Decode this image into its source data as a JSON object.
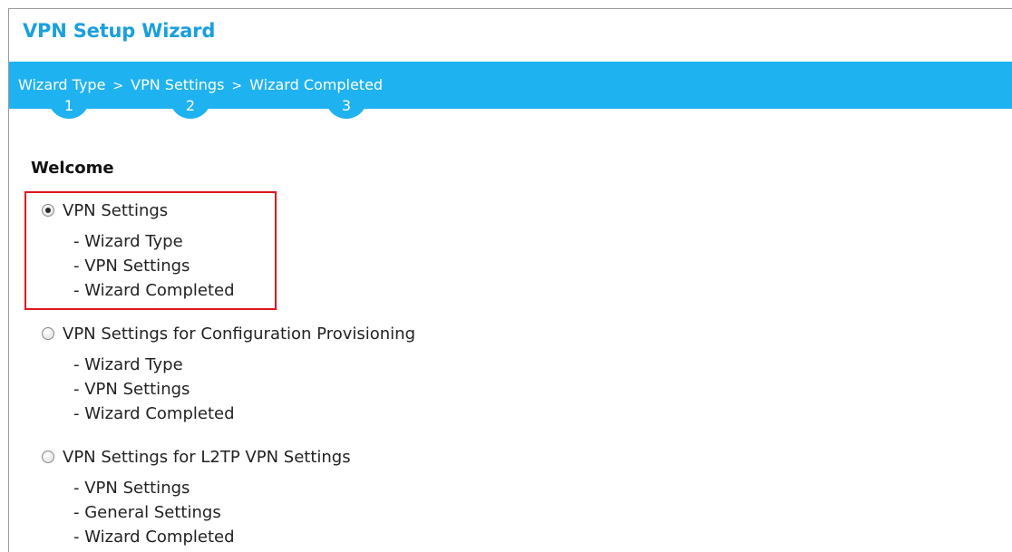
{
  "wizard": {
    "title": "VPN Setup Wizard",
    "steps": [
      {
        "label": "Wizard Type",
        "number": "1"
      },
      {
        "label": "VPN Settings",
        "number": "2"
      },
      {
        "label": "Wizard Completed",
        "number": "3"
      }
    ],
    "separator": ">",
    "section_heading": "Welcome",
    "options": [
      {
        "label": "VPN Settings",
        "checked": true,
        "substeps": [
          "- Wizard Type",
          "- VPN Settings",
          "- Wizard Completed"
        ]
      },
      {
        "label": "VPN Settings for Configuration Provisioning",
        "checked": false,
        "substeps": [
          "- Wizard Type",
          "- VPN Settings",
          "- Wizard Completed"
        ]
      },
      {
        "label": "VPN Settings for L2TP VPN Settings",
        "checked": false,
        "substeps": [
          "- VPN Settings",
          "- General Settings",
          "- Wizard Completed"
        ]
      }
    ]
  },
  "colors": {
    "title": "#1aa0dd",
    "step_bar": "#1fb2f0",
    "highlight_border": "#e0161e"
  },
  "icons": {
    "step_separator": "chevron-right-icon",
    "radio": "radio-button-icon"
  }
}
